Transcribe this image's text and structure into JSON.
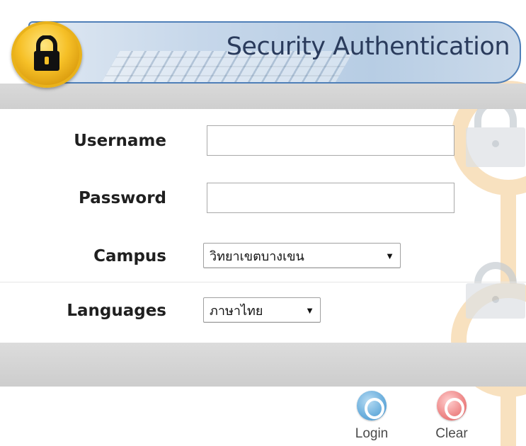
{
  "header": {
    "title": "Security Authentication",
    "badge_icon": "padlock-icon",
    "badge_color": "#f6c027",
    "border_color": "#4f7fb8"
  },
  "form": {
    "username": {
      "label": "Username",
      "value": "",
      "placeholder": ""
    },
    "password": {
      "label": "Password",
      "value": "",
      "placeholder": ""
    },
    "campus": {
      "label": "Campus",
      "selected": "วิทยาเขตบางเขน"
    },
    "languages": {
      "label": "Languages",
      "selected": "ภาษาไทย"
    }
  },
  "actions": {
    "login": {
      "label": "Login",
      "icon": "power-icon",
      "color": "#6fb1de"
    },
    "clear": {
      "label": "Clear",
      "icon": "power-icon",
      "color": "#ef8b8b"
    }
  },
  "watermark": {
    "icon": "key-lock-watermark-icon",
    "color": "#f7d3a0"
  }
}
